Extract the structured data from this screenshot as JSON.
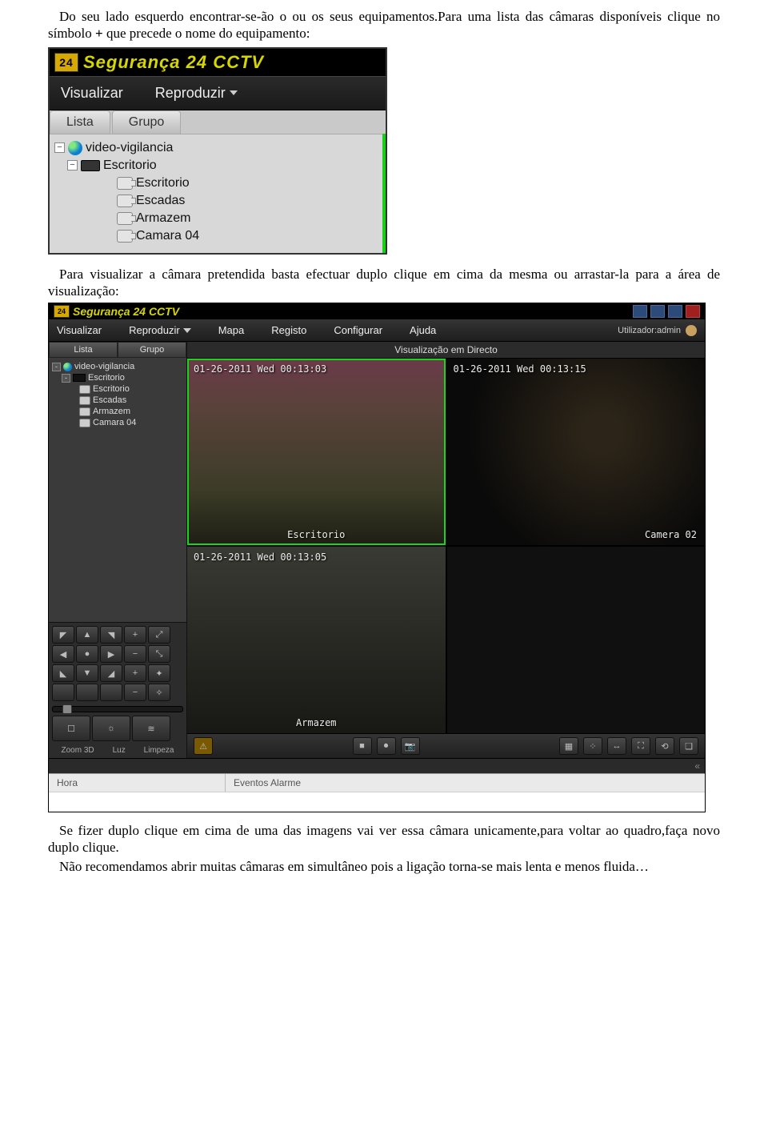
{
  "paragraphs": {
    "p1a": "Do seu lado esquerdo encontrar-se-ão o ou os seus equipamentos.Para uma lista das câmaras disponíveis clique no símbolo ",
    "plus": "+",
    "p1b": " que precede o nome do equipamento:",
    "p2": "Para visualizar a câmara pretendida basta efectuar duplo clique em cima da mesma ou arrastar-la para a área de visualização:",
    "p3": "Se fizer duplo clique em cima de uma das imagens vai ver essa câmara unicamente,para voltar ao quadro,faça novo duplo clique.",
    "p4": "Não recomendamos abrir muitas câmaras em simultâneo pois a ligação torna-se mais lenta e menos fluida…"
  },
  "fig1": {
    "logo_text": "24",
    "brand": "Segurança 24 CCTV",
    "menu": {
      "visualizar": "Visualizar",
      "reproduzir": "Reproduzir"
    },
    "tabs": {
      "lista": "Lista",
      "grupo": "Grupo"
    },
    "tree": {
      "root": "video-vigilancia",
      "dvr": "Escritorio",
      "cams": [
        "Escritorio",
        "Escadas",
        "Armazem",
        "Camara 04"
      ]
    }
  },
  "fig2": {
    "brand": "Segurança 24 CCTV",
    "menu": {
      "visualizar": "Visualizar",
      "reproduzir": "Reproduzir",
      "mapa": "Mapa",
      "registo": "Registo",
      "configurar": "Configurar",
      "ajuda": "Ajuda"
    },
    "user_label": "Utilizador:admin",
    "side_tabs": {
      "lista": "Lista",
      "grupo": "Grupo"
    },
    "tree": {
      "root": "video-vigilancia",
      "dvr": "Escritorio",
      "cams": [
        "Escritorio",
        "Escadas",
        "Armazem",
        "Camara 04"
      ]
    },
    "ptz": {
      "arrows": [
        "◤",
        "▲",
        "◥",
        "+",
        "⤢",
        "◀",
        "●",
        "▶",
        "−",
        "⤡",
        "◣",
        "▼",
        "◢",
        "+",
        "✦",
        "",
        "",
        "",
        "−",
        "✧"
      ],
      "labels": [
        "Zoom 3D",
        "Luz",
        "Limpeza"
      ]
    },
    "main_title": "Visualização em Directo",
    "cells": {
      "c1": {
        "ts": "01-26-2011 Wed 00:13:03",
        "label": "Escritorio"
      },
      "c2": {
        "ts": "01-26-2011 Wed 00:13:15",
        "label": "Camera 02"
      },
      "c3": {
        "ts": "01-26-2011 Wed 00:13:05",
        "label": "Armazem"
      }
    },
    "toolbar_icons": [
      "⚠",
      "■",
      "⏺",
      "📷",
      "▦",
      "⁘",
      "↔",
      "⛶",
      "⟲",
      "❏"
    ],
    "expand": "«",
    "status": {
      "hora": "Hora",
      "eventos": "Eventos Alarme"
    }
  }
}
